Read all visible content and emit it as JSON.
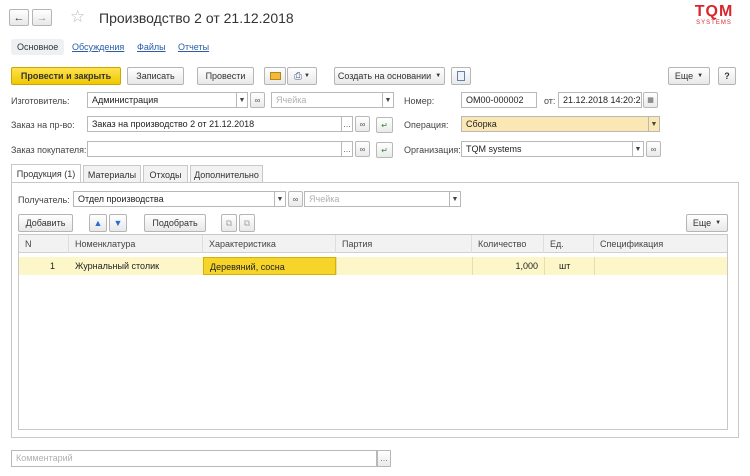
{
  "window": {
    "title": "Производство 2 от 21.12.2018",
    "logo_text": "TQM",
    "logo_sub": "SYSTEMS"
  },
  "top_tabs": [
    "Основное",
    "Обсуждения",
    "Файлы",
    "Отчеты"
  ],
  "toolbar": {
    "post_close": "Провести и закрыть",
    "write": "Записать",
    "post": "Провести",
    "create_based": "Создать на основании",
    "more": "Еще",
    "help": "?"
  },
  "form": {
    "manufacturer_label": "Изготовитель:",
    "manufacturer_value": "Администрация",
    "cell_placeholder": "Ячейка",
    "number_label": "Номер:",
    "number_value": "ОМ00-000002",
    "date_label": "от:",
    "date_value": "21.12.2018 14:20:25",
    "prod_order_label": "Заказ на пр-во:",
    "prod_order_value": "Заказ на производство 2 от 21.12.2018",
    "operation_label": "Операция:",
    "operation_value": "Сборка",
    "customer_order_label": "Заказ покупателя:",
    "customer_order_value": "",
    "org_label": "Организация:",
    "org_value": "TQM systems"
  },
  "inner_tabs": [
    "Продукция (1)",
    "Материалы",
    "Отходы",
    "Дополнительно"
  ],
  "products": {
    "recipient_label": "Получатель:",
    "recipient_value": "Отдел производства",
    "cell_placeholder": "Ячейка",
    "add_button": "Добавить",
    "pick_button": "Подобрать",
    "more": "Еще",
    "columns": [
      "N",
      "Номенклатура",
      "Характеристика",
      "Партия",
      "Количество",
      "Ед.",
      "Спецификация"
    ],
    "rows": [
      {
        "n": "1",
        "item": "Журнальный столик",
        "characteristic": "Деревяний, сосна",
        "batch": "",
        "qty": "1,000",
        "unit": "шт",
        "spec": ""
      }
    ]
  },
  "comment_placeholder": "Комментарий",
  "colors": {
    "primary_button": "#f0c800",
    "selected_row": "#fdf6c8",
    "highlighted_cell": "#f7d42a",
    "operation_field": "#fbe7b3",
    "logo_red": "#d9262c"
  }
}
